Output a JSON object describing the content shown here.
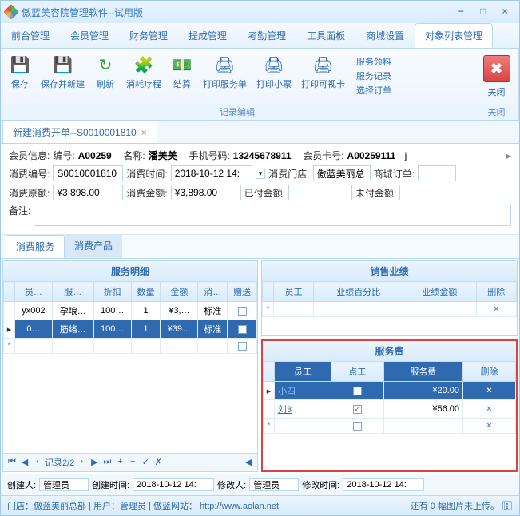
{
  "title": "傲蓝美容院管理软件--试用版",
  "menus": [
    "前台管理",
    "会员管理",
    "财务管理",
    "提成管理",
    "考勤管理",
    "工具面板",
    "商城设置",
    "对象列表管理"
  ],
  "ribbon": {
    "group1_title": "记录编辑",
    "save": "保存",
    "saveNew": "保存并新建",
    "refresh": "刷新",
    "consume": "消耗疗程",
    "settle": "结算",
    "printSvc": "打印服务单",
    "printSlip": "打印小票",
    "printCard": "打印可视卡",
    "link1": "服务领料",
    "link2": "服务记录",
    "link3": "选择订单",
    "close_title": "关闭",
    "close_btn": "关闭"
  },
  "docTab": "新建消费开单--S0010001810",
  "member": {
    "label": "会员信息:",
    "numLabel": "编号:",
    "num": "A00259",
    "nameLabel": "名称:",
    "name": "潘美美",
    "phoneLabel": "手机号码:",
    "phone": "13245678911",
    "cardLabel": "会员卡号:",
    "card": "A00259111",
    "suffix": "j"
  },
  "form": {
    "billNoLabel": "消费编号:",
    "billNo": "S0010001810",
    "timeLabel": "消费时间:",
    "time": "2018-10-12 14:",
    "storeLabel": "消费门店:",
    "store": "傲蓝美丽总",
    "mallLabel": "商城订单:",
    "mall": "",
    "origLabel": "消费原额:",
    "orig": "¥3,898.00",
    "amtLabel": "消费金额:",
    "amt": "¥3,898.00",
    "paidLabel": "已付金额:",
    "paid": "",
    "unpaidLabel": "未付金额:",
    "unpaid": "",
    "remarkLabel": "备注:"
  },
  "innerTabs": [
    "消费服务",
    "消费产品"
  ],
  "svcDetail": {
    "title": "服务明细",
    "cols": [
      "员…",
      "服…",
      "折扣",
      "数量",
      "金额",
      "消…",
      "赠送"
    ],
    "rows": [
      [
        "yx002",
        "孕埌…",
        "100…",
        "1",
        "¥3,…",
        "标准",
        ""
      ],
      [
        "0…",
        "筋络…",
        "100…",
        "1",
        "¥39…",
        "标准",
        ""
      ]
    ],
    "navRecord": "记录2/2"
  },
  "sales": {
    "title": "销售业绩",
    "cols": [
      "员工",
      "业绩百分比",
      "业绩金额",
      "删除"
    ]
  },
  "fee": {
    "title": "服务费",
    "cols": [
      "员工",
      "点工",
      "服务费",
      "删除"
    ],
    "rows": [
      {
        "emp": "小四",
        "pt": false,
        "fee": "¥20.00",
        "sel": true
      },
      {
        "emp": "刘3",
        "pt": true,
        "fee": "¥56.00",
        "sel": false
      }
    ]
  },
  "footer": {
    "creatorLabel": "创建人:",
    "creator": "管理员",
    "ctimeLabel": "创建时间:",
    "ctime": "2018-10-12 14:",
    "modLabel": "修改人:",
    "mod": "管理员",
    "mtimeLabel": "修改时间:",
    "mtime": "2018-10-12 14:"
  },
  "status": {
    "store": "门店：傲蓝美丽总部",
    "user": "用户：管理员",
    "siteLabel": "傲蓝网站：",
    "siteUrl": "http://www.aolan.net",
    "img": "还有 0 幅图片未上传。"
  }
}
